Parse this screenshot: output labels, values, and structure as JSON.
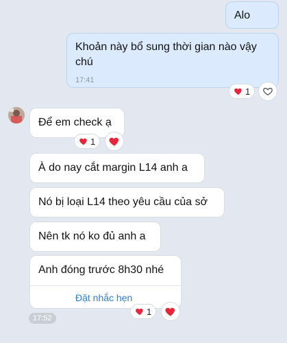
{
  "messages": {
    "m1": {
      "text": "Alo"
    },
    "m2": {
      "text": "Khoản này bổ sung thời gian nào vậy chú",
      "time": "17:41"
    },
    "m3": {
      "text": "Để em check ạ"
    },
    "m4": {
      "text": "À do nay cắt margin L14 anh a"
    },
    "m5": {
      "text": "Nó bị loại L14 theo yêu cầu của sở"
    },
    "m6": {
      "text": "Nên tk nó ko đủ anh a"
    },
    "m7": {
      "text": "Anh đóng trước 8h30 nhé",
      "action": "Đặt nhắc hẹn"
    }
  },
  "reactions": {
    "r2": {
      "count": "1",
      "icon": "heart-icon"
    },
    "r3": {
      "count": "1",
      "icon": "heart-icon"
    },
    "r7": {
      "count": "1",
      "icon": "heart-icon"
    }
  },
  "group_time": "17:52",
  "colors": {
    "heart": "#e8253b",
    "outgoing": "#dbeafd",
    "incoming": "#ffffff",
    "link": "#2d7fd6"
  }
}
